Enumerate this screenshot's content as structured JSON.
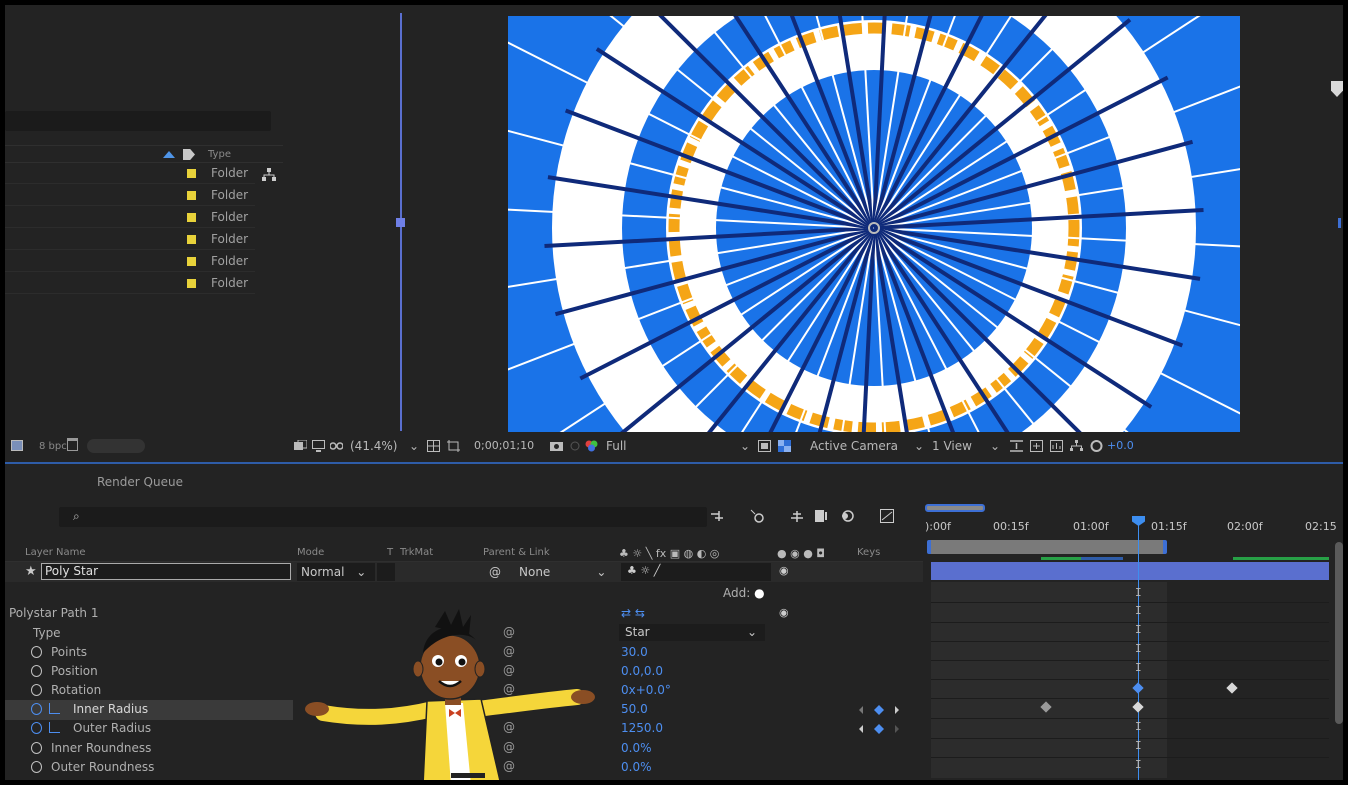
{
  "project": {
    "type_header": "Type",
    "rows": [
      {
        "type": "Folder"
      },
      {
        "type": "Folder"
      },
      {
        "type": "Folder"
      },
      {
        "type": "Folder"
      },
      {
        "type": "Folder"
      },
      {
        "type": "Folder"
      }
    ],
    "bpc": "8 bpc"
  },
  "viewer_toolbar": {
    "zoom": "(41.4%)",
    "timecode": "0;00;01;10",
    "resolution": "Full",
    "camera": "Active Camera",
    "views": "1 View",
    "exposure": "+0.0"
  },
  "timeline": {
    "tab": "Render Queue",
    "search_icon": "search-icon",
    "columns": {
      "layer_name": "Layer Name",
      "mode": "Mode",
      "t": "T",
      "trkmat": "TrkMat",
      "parent": "Parent & Link",
      "keys": "Keys"
    },
    "layer": {
      "name": "Poly Star",
      "mode": "Normal",
      "parent": "None"
    },
    "add_label": "Add:",
    "group": "Polystar Path 1",
    "properties": [
      {
        "label": "Type",
        "value": "Star"
      },
      {
        "label": "Points",
        "value": "30.0"
      },
      {
        "label": "Position",
        "value": "0.0,0.0"
      },
      {
        "label": "Rotation",
        "value": "0x+0.0°"
      },
      {
        "label": "Inner Radius",
        "value": "50.0"
      },
      {
        "label": "Outer Radius",
        "value": "1250.0"
      },
      {
        "label": "Inner Roundness",
        "value": "0.0%"
      },
      {
        "label": "Outer Roundness",
        "value": "0.0%"
      }
    ],
    "ruler": [
      "):00f",
      "00:15f",
      "01:00f",
      "01:15f",
      "02:00f",
      "02:15"
    ]
  },
  "colors": {
    "comp_bg": "#1a73e8",
    "accent_blue": "#4d8ef0",
    "orange_ring": "#f5a516",
    "folder_label": "#e8d23a",
    "layer_bar": "#5a6fcf"
  }
}
